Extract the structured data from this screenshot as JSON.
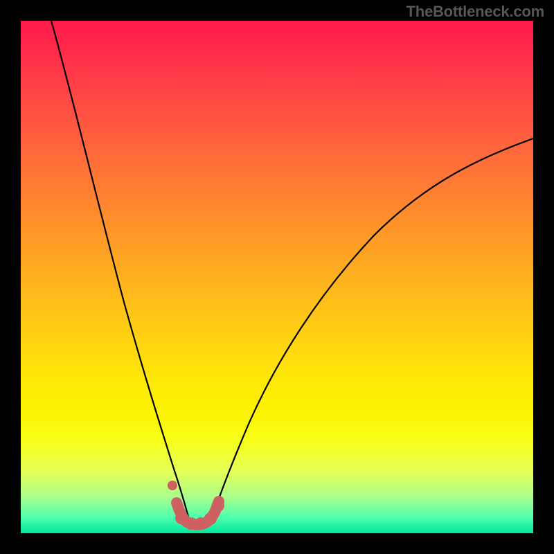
{
  "attribution": "TheBottleneck.com",
  "colors": {
    "background": "#000000",
    "gradient_top": "#ff1a4a",
    "gradient_bottom": "#00e79a",
    "curve": "#000000",
    "highlight": "#cf6062",
    "attribution_text": "#575757"
  },
  "chart_data": {
    "type": "line",
    "title": "",
    "xlabel": "",
    "ylabel": "",
    "xlim": [
      0,
      100
    ],
    "ylim": [
      0,
      100
    ],
    "grid": false,
    "legend": false,
    "background": "rainbow-gradient",
    "series": [
      {
        "name": "left-branch",
        "x": [
          6,
          8,
          10,
          12,
          14,
          16,
          18,
          20,
          22,
          24,
          26,
          28,
          29.5,
          31,
          32.5
        ],
        "y": [
          100,
          91,
          82,
          73,
          64,
          56,
          48,
          40,
          33,
          26,
          19,
          13,
          8,
          4.5,
          2.5
        ]
      },
      {
        "name": "right-branch",
        "x": [
          37.5,
          39,
          41,
          44,
          48,
          53,
          59,
          66,
          74,
          82,
          90,
          100
        ],
        "y": [
          2.5,
          5,
          10,
          18,
          27,
          37,
          47,
          56,
          63,
          69,
          73,
          77
        ]
      },
      {
        "name": "highlight-segment",
        "x": [
          29.5,
          31,
          32.5,
          34,
          35.5,
          37,
          38.5
        ],
        "y": [
          8,
          4.5,
          2.5,
          1.8,
          2.2,
          4,
          6.5
        ]
      }
    ]
  }
}
